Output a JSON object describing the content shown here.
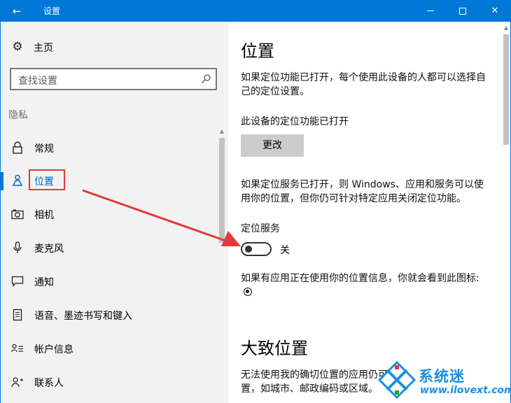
{
  "titlebar": {
    "back_icon": "back-arrow-icon",
    "title": "设置",
    "accent": "#0078d7"
  },
  "sidebar": {
    "home_label": "主页",
    "search_placeholder": "查找设置",
    "section_title": "隐私",
    "items": [
      {
        "label": "常规",
        "icon": "lock-icon"
      },
      {
        "label": "位置",
        "icon": "location-person-icon",
        "selected": true
      },
      {
        "label": "相机",
        "icon": "camera-icon"
      },
      {
        "label": "麦克风",
        "icon": "microphone-icon"
      },
      {
        "label": "通知",
        "icon": "notification-icon"
      },
      {
        "label": "语音、墨迹书写和键入",
        "icon": "speech-document-icon"
      },
      {
        "label": "帐户信息",
        "icon": "account-info-icon"
      },
      {
        "label": "联系人",
        "icon": "contacts-icon"
      }
    ]
  },
  "main": {
    "title": "位置",
    "intro": "如果定位功能已打开，每个使用此设备的人都可以选择自己的定位设置。",
    "device_status": "此设备的定位功能已打开",
    "change_button": "更改",
    "service_desc": "如果定位服务已打开，则 Windows、应用和服务可以使用你的位置，但你仍可针对特定应用关闭定位功能。",
    "service_label": "定位服务",
    "toggle_state": "关",
    "toggle_on": false,
    "icon_note": "如果有应用正在使用你的位置信息，你就会看到此图标:",
    "approx_title": "大致位置",
    "approx_desc_line1": "无法使用我的确切位置的应用仍可使",
    "approx_desc_line2": "置，如城市、邮政编码或区域。"
  },
  "annotations": {
    "highlight_color": "#e23a3a"
  },
  "watermark": {
    "text": "系统迷",
    "url": "www.ilovext.com"
  }
}
